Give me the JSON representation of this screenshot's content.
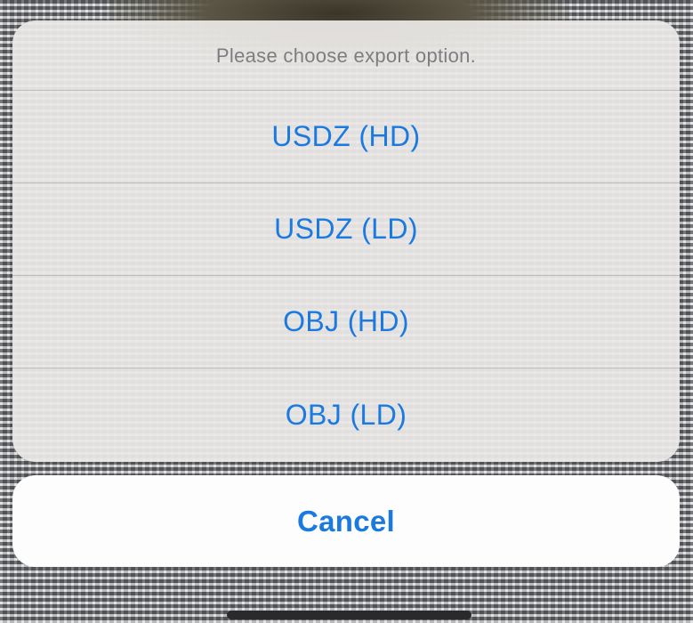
{
  "action_sheet": {
    "message": "Please choose export option.",
    "options": [
      {
        "label": "USDZ (HD)"
      },
      {
        "label": "USDZ (LD)"
      },
      {
        "label": "OBJ (HD)"
      },
      {
        "label": "OBJ (LD)"
      }
    ],
    "cancel_label": "Cancel"
  },
  "colors": {
    "accent": "#1b7ae0",
    "message_text": "#7d7d80",
    "sheet_background": "#eceae7",
    "cancel_background": "#fdfdfd"
  }
}
